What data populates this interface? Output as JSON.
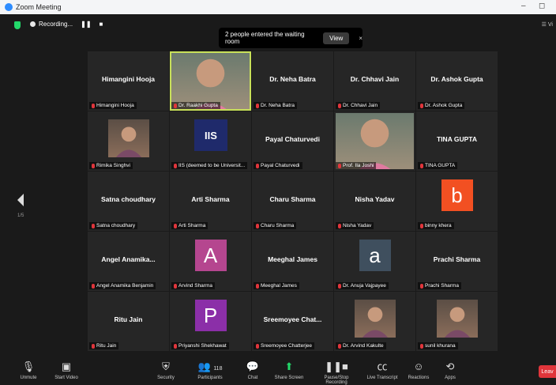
{
  "window": {
    "title": "Zoom Meeting"
  },
  "top": {
    "recording_label": "Recording...",
    "view_label": "Vi"
  },
  "toast": {
    "message": "2 people entered the waiting room",
    "view_button": "View",
    "close": "×"
  },
  "pager": {
    "page": "1/5"
  },
  "tiles": [
    {
      "kind": "name",
      "display": "Himangini Hooja",
      "label": "Himangini Hooja"
    },
    {
      "kind": "video",
      "display": "",
      "label": "Dr. Raakhi Gupta"
    },
    {
      "kind": "name",
      "display": "Dr. Neha Batra",
      "label": "Dr. Neha Batra"
    },
    {
      "kind": "name",
      "display": "Dr. Chhavi Jain",
      "label": "Dr. Chhavi Jain"
    },
    {
      "kind": "name",
      "display": "Dr. Ashok Gupta",
      "label": "Dr. Ashok Gupta"
    },
    {
      "kind": "photo",
      "display": "",
      "label": "Rimika Singhvi"
    },
    {
      "kind": "logo",
      "display": "IIS",
      "label": "IIS (deemed to be Universit..."
    },
    {
      "kind": "name",
      "display": "Payal Chaturvedi",
      "label": "Payal Chaturvedi"
    },
    {
      "kind": "video",
      "display": "",
      "label": "Prof. Ila Joshi"
    },
    {
      "kind": "name",
      "display": "TINA GUPTA",
      "label": "TINA GUPTA"
    },
    {
      "kind": "name",
      "display": "Satna choudhary",
      "label": "Satna choudhary"
    },
    {
      "kind": "name",
      "display": "Arti Sharma",
      "label": "Arti Sharma"
    },
    {
      "kind": "name",
      "display": "Charu Sharma",
      "label": "Charu Sharma"
    },
    {
      "kind": "name",
      "display": "Nisha Yadav",
      "label": "Nisha Yadav"
    },
    {
      "kind": "avatar",
      "display": "b",
      "color": "#f25022",
      "label": "binny khera"
    },
    {
      "kind": "name",
      "display": "Angel Anamika...",
      "label": "Angel Anamika Benjamin"
    },
    {
      "kind": "avatar",
      "display": "A",
      "color": "#b5468f",
      "label": "Arvind Sharma"
    },
    {
      "kind": "name",
      "display": "Meeghal James",
      "label": "Meeghal James"
    },
    {
      "kind": "avatar",
      "display": "a",
      "color": "#3f4f5e",
      "label": "Dr. Anuja Vajpayee"
    },
    {
      "kind": "name",
      "display": "Prachi Sharma",
      "label": "Prachi Sharma"
    },
    {
      "kind": "name",
      "display": "Ritu Jain",
      "label": "Ritu Jain"
    },
    {
      "kind": "avatar",
      "display": "P",
      "color": "#8b2fa8",
      "label": "Priyanshi Shekhawat"
    },
    {
      "kind": "name",
      "display": "Sreemoyee Chat...",
      "label": "Sreemoyee Chatterjee"
    },
    {
      "kind": "photo",
      "display": "",
      "label": "Dr. Arvind Kakulte"
    },
    {
      "kind": "photo",
      "display": "",
      "label": "sunil khurana"
    }
  ],
  "toolbar": {
    "unmute": "Unmute",
    "start_video": "Start Video",
    "security": "Security",
    "participants": "Participants",
    "participants_count": "118",
    "chat": "Chat",
    "share_screen": "Share Screen",
    "pause_recording": "Pause/Stop Recording",
    "live_transcript": "Live Transcript",
    "reactions": "Reactions",
    "apps": "Apps",
    "leave": "Leav"
  }
}
